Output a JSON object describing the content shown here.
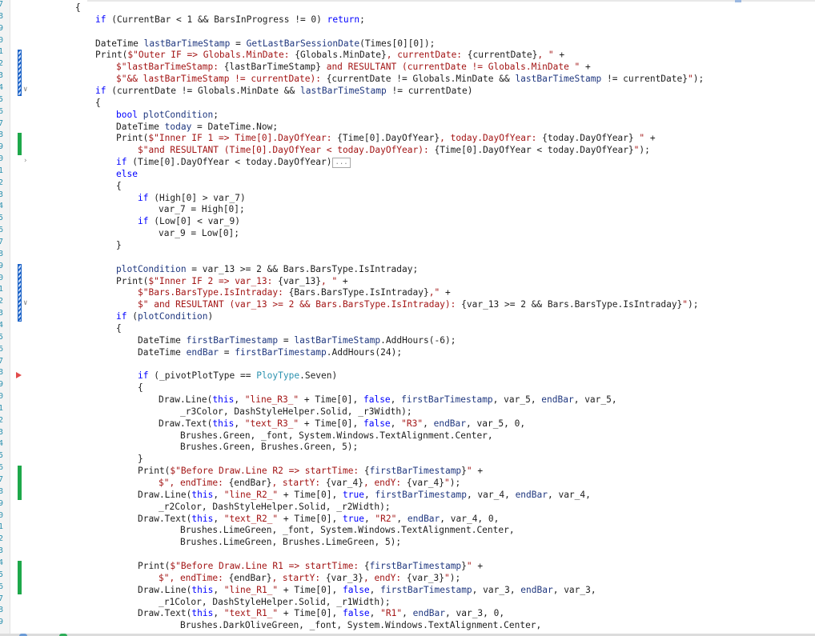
{
  "editor": {
    "line_numbers": [
      "7",
      "8",
      "9",
      "0",
      "1",
      "2",
      "3",
      "4",
      "5",
      "6",
      "7",
      "8",
      "9",
      "0",
      "1",
      "2",
      "3",
      "4",
      "5",
      "6",
      "7",
      "8",
      "9",
      "0",
      "1",
      "2",
      "3",
      "4",
      "5",
      "6",
      "7",
      "8",
      "9",
      "0",
      "1",
      "2",
      "3",
      "4",
      "5",
      "6",
      "7",
      "8",
      "9",
      "0",
      "1",
      "2",
      "3",
      "4",
      "5",
      "6",
      "7",
      "8",
      "9"
    ],
    "lines": [
      {
        "indent": 0,
        "tokens": [
          [
            "t",
            "{"
          ]
        ]
      },
      {
        "indent": 1,
        "tokens": [
          [
            "k",
            "if"
          ],
          [
            "t",
            " (CurrentBar < 1 && BarsInProgress != 0) "
          ],
          [
            "k",
            "return"
          ],
          [
            "t",
            ";"
          ]
        ]
      },
      {
        "indent": 1,
        "tokens": []
      },
      {
        "indent": 1,
        "tokens": [
          [
            "t",
            "DateTime "
          ],
          [
            "f",
            "lastBarTimeStamp"
          ],
          [
            "t",
            " = "
          ],
          [
            "f",
            "GetLastBarSessionDate"
          ],
          [
            "t",
            "(Times[0][0]);"
          ]
        ]
      },
      {
        "indent": 1,
        "tokens": [
          [
            "t",
            "Print("
          ],
          [
            "s",
            "$\"Outer IF => Globals.MinDate: "
          ],
          [
            "t",
            "{Globals.MinDate}"
          ],
          [
            "s",
            ", currentDate: "
          ],
          [
            "t",
            "{currentDate}"
          ],
          [
            "s",
            ", \""
          ],
          [
            "t",
            " +"
          ]
        ]
      },
      {
        "indent": 2,
        "tokens": [
          [
            "s",
            "$\"lastBarTimeStamp: "
          ],
          [
            "t",
            "{lastBarTimeStamp}"
          ],
          [
            "s",
            " and RESULTANT (currentDate != Globals.MinDate \""
          ],
          [
            "t",
            " +"
          ]
        ]
      },
      {
        "indent": 2,
        "tokens": [
          [
            "s",
            "$\"&& lastBarTimeStamp != currentDate): "
          ],
          [
            "t",
            "{currentDate != Globals.MinDate && "
          ],
          [
            "f",
            "lastBarTimeStamp"
          ],
          [
            "t",
            " != currentDate}"
          ],
          [
            "s",
            "\""
          ],
          [
            "t",
            ");"
          ]
        ]
      },
      {
        "indent": 1,
        "tokens": [
          [
            "k",
            "if"
          ],
          [
            "t",
            " (currentDate != Globals.MinDate && "
          ],
          [
            "f",
            "lastBarTimeStamp"
          ],
          [
            "t",
            " != currentDate)"
          ]
        ]
      },
      {
        "indent": 1,
        "tokens": [
          [
            "t",
            "{"
          ]
        ]
      },
      {
        "indent": 2,
        "tokens": [
          [
            "k",
            "bool"
          ],
          [
            "t",
            " "
          ],
          [
            "f",
            "plotCondition"
          ],
          [
            "t",
            ";"
          ]
        ]
      },
      {
        "indent": 2,
        "tokens": [
          [
            "t",
            "DateTime "
          ],
          [
            "f",
            "today"
          ],
          [
            "t",
            " = DateTime.Now;"
          ]
        ]
      },
      {
        "indent": 2,
        "tokens": [
          [
            "t",
            "Print("
          ],
          [
            "s",
            "$\"Inner IF 1 => Time[0].DayOfYear: "
          ],
          [
            "t",
            "{Time[0].DayOfYear}"
          ],
          [
            "s",
            ", today.DayOfYear: "
          ],
          [
            "t",
            "{today.DayOfYear}"
          ],
          [
            "s",
            " \""
          ],
          [
            "t",
            " +"
          ]
        ]
      },
      {
        "indent": 3,
        "tokens": [
          [
            "s",
            "$\"and RESULTANT (Time[0].DayOfYear < today.DayOfYear): "
          ],
          [
            "t",
            "{Time[0].DayOfYear < today.DayOfYear}"
          ],
          [
            "s",
            "\""
          ],
          [
            "t",
            ");"
          ]
        ]
      },
      {
        "indent": 2,
        "tokens": [
          [
            "k",
            "if"
          ],
          [
            "t",
            " (Time[0].DayOfYear < today.DayOfYear)"
          ],
          [
            "c",
            "..."
          ]
        ]
      },
      {
        "indent": 2,
        "tokens": [
          [
            "k",
            "else"
          ]
        ]
      },
      {
        "indent": 2,
        "tokens": [
          [
            "t",
            "{"
          ]
        ]
      },
      {
        "indent": 3,
        "tokens": [
          [
            "k",
            "if"
          ],
          [
            "t",
            " (High[0] > var_7)"
          ]
        ]
      },
      {
        "indent": 4,
        "tokens": [
          [
            "t",
            "var_7 = High[0];"
          ]
        ]
      },
      {
        "indent": 3,
        "tokens": [
          [
            "k",
            "if"
          ],
          [
            "t",
            " (Low[0] < var_9)"
          ]
        ]
      },
      {
        "indent": 4,
        "tokens": [
          [
            "t",
            "var_9 = Low[0];"
          ]
        ]
      },
      {
        "indent": 2,
        "tokens": [
          [
            "t",
            "}"
          ]
        ]
      },
      {
        "indent": 2,
        "tokens": []
      },
      {
        "indent": 2,
        "tokens": [
          [
            "f",
            "plotCondition"
          ],
          [
            "t",
            " = var_13 >= 2 && Bars.BarsType.IsIntraday;"
          ]
        ]
      },
      {
        "indent": 2,
        "tokens": [
          [
            "t",
            "Print("
          ],
          [
            "s",
            "$\"Inner IF 2 => var_13: "
          ],
          [
            "t",
            "{var_13}"
          ],
          [
            "s",
            ", \""
          ],
          [
            "t",
            " +"
          ]
        ]
      },
      {
        "indent": 3,
        "tokens": [
          [
            "s",
            "$\"Bars.BarsType.IsIntraday: "
          ],
          [
            "t",
            "{Bars.BarsType.IsIntraday}"
          ],
          [
            "s",
            ",\""
          ],
          [
            "t",
            " +"
          ]
        ]
      },
      {
        "indent": 3,
        "tokens": [
          [
            "s",
            "$\" and RESULTANT (var_13 >= 2 && Bars.BarsType.IsIntraday): "
          ],
          [
            "t",
            "{var_13 >= 2 && Bars.BarsType.IsIntraday}"
          ],
          [
            "s",
            "\""
          ],
          [
            "t",
            ");"
          ]
        ]
      },
      {
        "indent": 2,
        "tokens": [
          [
            "k",
            "if"
          ],
          [
            "t",
            " ("
          ],
          [
            "f",
            "plotCondition"
          ],
          [
            "t",
            ")"
          ]
        ]
      },
      {
        "indent": 2,
        "tokens": [
          [
            "t",
            "{"
          ]
        ]
      },
      {
        "indent": 3,
        "tokens": [
          [
            "t",
            "DateTime "
          ],
          [
            "f",
            "firstBarTimestamp"
          ],
          [
            "t",
            " = "
          ],
          [
            "f",
            "lastBarTimeStamp"
          ],
          [
            "t",
            ".AddHours(-6);"
          ]
        ]
      },
      {
        "indent": 3,
        "tokens": [
          [
            "t",
            "DateTime "
          ],
          [
            "f",
            "endBar"
          ],
          [
            "t",
            " = "
          ],
          [
            "f",
            "firstBarTimestamp"
          ],
          [
            "t",
            ".AddHours(24);"
          ]
        ]
      },
      {
        "indent": 3,
        "tokens": []
      },
      {
        "indent": 3,
        "tokens": [
          [
            "k",
            "if"
          ],
          [
            "t",
            " (_pivotPlotType == "
          ],
          [
            "y",
            "PloyType"
          ],
          [
            "t",
            ".Seven)"
          ]
        ]
      },
      {
        "indent": 3,
        "tokens": [
          [
            "t",
            "{"
          ]
        ]
      },
      {
        "indent": 4,
        "tokens": [
          [
            "t",
            "Draw.Line("
          ],
          [
            "k",
            "this"
          ],
          [
            "t",
            ", "
          ],
          [
            "s",
            "\"line_R3_\""
          ],
          [
            "t",
            " + Time[0], "
          ],
          [
            "k",
            "false"
          ],
          [
            "t",
            ", "
          ],
          [
            "f",
            "firstBarTimestamp"
          ],
          [
            "t",
            ", var_5, "
          ],
          [
            "f",
            "endBar"
          ],
          [
            "t",
            ", var_5,"
          ]
        ]
      },
      {
        "indent": 5,
        "tokens": [
          [
            "t",
            "_r3Color, DashStyleHelper.Solid, _r3Width);"
          ]
        ]
      },
      {
        "indent": 4,
        "tokens": [
          [
            "t",
            "Draw.Text("
          ],
          [
            "k",
            "this"
          ],
          [
            "t",
            ", "
          ],
          [
            "s",
            "\"text_R3_\""
          ],
          [
            "t",
            " + Time[0], "
          ],
          [
            "k",
            "false"
          ],
          [
            "t",
            ", "
          ],
          [
            "s",
            "\"R3\""
          ],
          [
            "t",
            ", "
          ],
          [
            "f",
            "endBar"
          ],
          [
            "t",
            ", var_5, 0,"
          ]
        ]
      },
      {
        "indent": 5,
        "tokens": [
          [
            "t",
            "Brushes.Green, _font, System.Windows.TextAlignment.Center,"
          ]
        ]
      },
      {
        "indent": 5,
        "tokens": [
          [
            "t",
            "Brushes.Green, Brushes.Green, 5);"
          ]
        ]
      },
      {
        "indent": 3,
        "tokens": [
          [
            "t",
            "}"
          ]
        ]
      },
      {
        "indent": 3,
        "tokens": [
          [
            "t",
            "Print("
          ],
          [
            "s",
            "$\"Before Draw.Line R2 => startTime: "
          ],
          [
            "t",
            "{"
          ],
          [
            "f",
            "firstBarTimestamp"
          ],
          [
            "t",
            "}"
          ],
          [
            "s",
            "\""
          ],
          [
            "t",
            " +"
          ]
        ]
      },
      {
        "indent": 4,
        "tokens": [
          [
            "s",
            "$\", endTime: "
          ],
          [
            "t",
            "{endBar}"
          ],
          [
            "s",
            ", startY: "
          ],
          [
            "t",
            "{var_4}"
          ],
          [
            "s",
            ", endY: "
          ],
          [
            "t",
            "{var_4}"
          ],
          [
            "s",
            "\""
          ],
          [
            "t",
            ");"
          ]
        ]
      },
      {
        "indent": 3,
        "tokens": [
          [
            "t",
            "Draw.Line("
          ],
          [
            "k",
            "this"
          ],
          [
            "t",
            ", "
          ],
          [
            "s",
            "\"line_R2_\""
          ],
          [
            "t",
            " + Time[0], "
          ],
          [
            "k",
            "true"
          ],
          [
            "t",
            ", "
          ],
          [
            "f",
            "firstBarTimestamp"
          ],
          [
            "t",
            ", var_4, "
          ],
          [
            "f",
            "endBar"
          ],
          [
            "t",
            ", var_4,"
          ]
        ]
      },
      {
        "indent": 4,
        "tokens": [
          [
            "t",
            "_r2Color, DashStyleHelper.Solid, _r2Width);"
          ]
        ]
      },
      {
        "indent": 3,
        "tokens": [
          [
            "t",
            "Draw.Text("
          ],
          [
            "k",
            "this"
          ],
          [
            "t",
            ", "
          ],
          [
            "s",
            "\"text_R2_\""
          ],
          [
            "t",
            " + Time[0], "
          ],
          [
            "k",
            "true"
          ],
          [
            "t",
            ", "
          ],
          [
            "s",
            "\"R2\""
          ],
          [
            "t",
            ", "
          ],
          [
            "f",
            "endBar"
          ],
          [
            "t",
            ", var_4, 0,"
          ]
        ]
      },
      {
        "indent": 5,
        "tokens": [
          [
            "t",
            "Brushes.LimeGreen, _font, System.Windows.TextAlignment.Center,"
          ]
        ]
      },
      {
        "indent": 5,
        "tokens": [
          [
            "t",
            "Brushes.LimeGreen, Brushes.LimeGreen, 5);"
          ]
        ]
      },
      {
        "indent": 3,
        "tokens": []
      },
      {
        "indent": 3,
        "tokens": [
          [
            "t",
            "Print("
          ],
          [
            "s",
            "$\"Before Draw.Line R1 => startTime: "
          ],
          [
            "t",
            "{"
          ],
          [
            "f",
            "firstBarTimestamp"
          ],
          [
            "t",
            "}"
          ],
          [
            "s",
            "\""
          ],
          [
            "t",
            " +"
          ]
        ]
      },
      {
        "indent": 4,
        "tokens": [
          [
            "s",
            "$\", endTime: "
          ],
          [
            "t",
            "{endBar}"
          ],
          [
            "s",
            ", startY: "
          ],
          [
            "t",
            "{var_3}"
          ],
          [
            "s",
            ", endY: "
          ],
          [
            "t",
            "{var_3}"
          ],
          [
            "s",
            "\""
          ],
          [
            "t",
            ");"
          ]
        ]
      },
      {
        "indent": 3,
        "tokens": [
          [
            "t",
            "Draw.Line("
          ],
          [
            "k",
            "this"
          ],
          [
            "t",
            ", "
          ],
          [
            "s",
            "\"line_R1_\""
          ],
          [
            "t",
            " + Time[0], "
          ],
          [
            "k",
            "false"
          ],
          [
            "t",
            ", "
          ],
          [
            "f",
            "firstBarTimestamp"
          ],
          [
            "t",
            ", var_3, "
          ],
          [
            "f",
            "endBar"
          ],
          [
            "t",
            ", var_3,"
          ]
        ]
      },
      {
        "indent": 4,
        "tokens": [
          [
            "t",
            "_r1Color, DashStyleHelper.Solid, _r1Width);"
          ]
        ]
      },
      {
        "indent": 3,
        "tokens": [
          [
            "t",
            "Draw.Text("
          ],
          [
            "k",
            "this"
          ],
          [
            "t",
            ", "
          ],
          [
            "s",
            "\"text_R1_\""
          ],
          [
            "t",
            " + Time[0], "
          ],
          [
            "k",
            "false"
          ],
          [
            "t",
            ", "
          ],
          [
            "s",
            "\"R1\""
          ],
          [
            "t",
            ", "
          ],
          [
            "f",
            "endBar"
          ],
          [
            "t",
            ", var_3, 0,"
          ]
        ]
      },
      {
        "indent": 5,
        "tokens": [
          [
            "t",
            "Brushes.DarkOliveGreen, _font, System.Windows.TextAlignment.Center,"
          ]
        ]
      }
    ],
    "gutter": {
      "saved_changes": [
        [
          11,
          12
        ],
        [
          39,
          41
        ],
        [
          47,
          49
        ]
      ],
      "unsaved_changes": [
        [
          4,
          7
        ],
        [
          22,
          26
        ]
      ],
      "fold_open": [
        6,
        7,
        13,
        25,
        27
      ],
      "fold_closed": [
        13
      ],
      "breakpoint_arrow": [
        31
      ]
    },
    "colors": {
      "keyword": "#0000ff",
      "string": "#a31515",
      "type": "#2b91af",
      "identifier": "#1f377f",
      "saved_change": "#1ea84a",
      "unsaved_change": "#1c63c7"
    }
  }
}
